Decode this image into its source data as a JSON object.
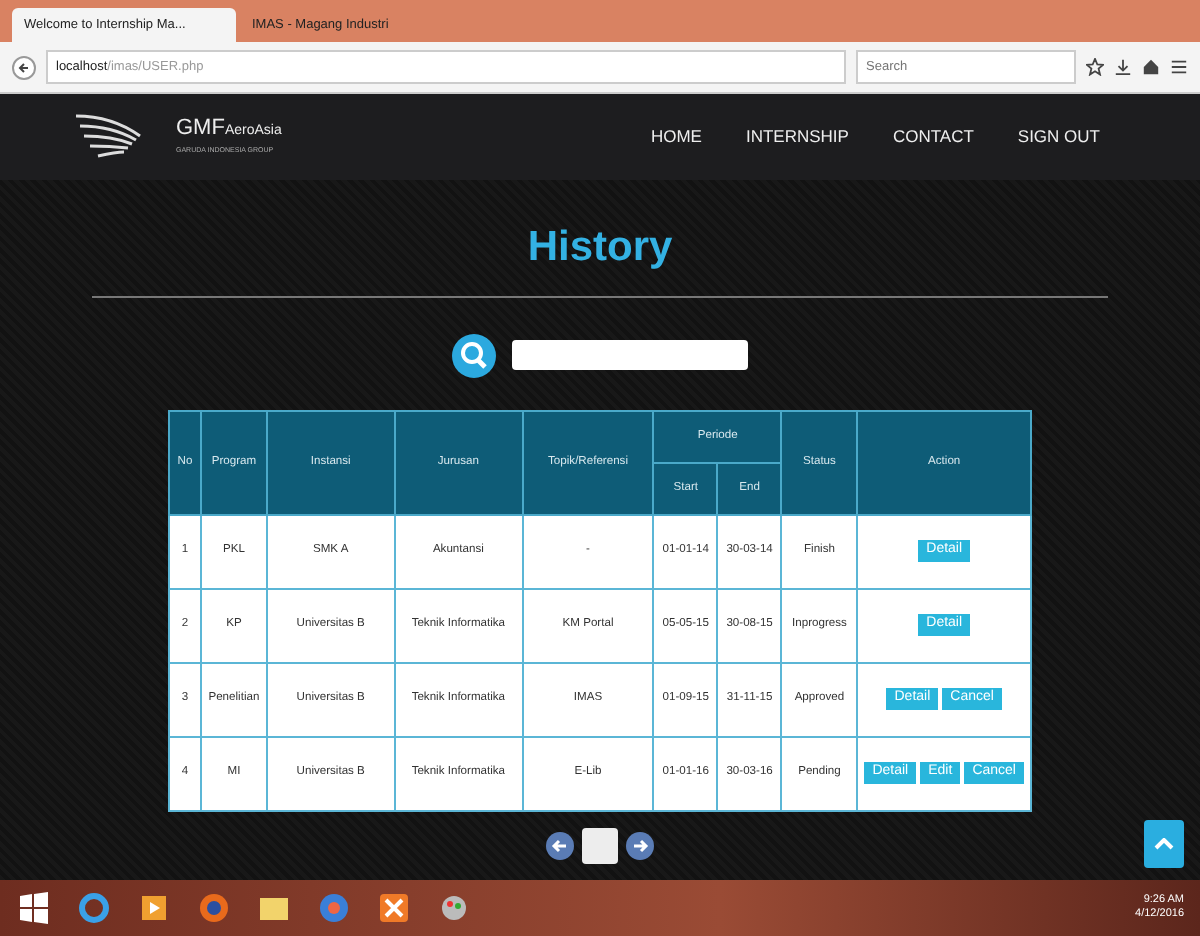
{
  "browser": {
    "tabs": [
      {
        "label": "Welcome to Internship Ma...",
        "selected": true
      },
      {
        "label": "IMAS - Magang Industri",
        "selected": false
      }
    ],
    "url_host": "localhost",
    "url_path": "/imas/USER.php",
    "search_placeholder": "Search"
  },
  "navbar": {
    "brand": "GMF",
    "brand_sub": "AeroAsia",
    "tagline": "GARUDA INDONESIA GROUP",
    "items": [
      "HOME",
      "INTERNSHIP",
      "CONTACT",
      "SIGN OUT"
    ]
  },
  "page": {
    "title": "History"
  },
  "table": {
    "columns": [
      {
        "label": "No"
      },
      {
        "label": "Program"
      },
      {
        "label": "Instansi"
      },
      {
        "label": "Jurusan"
      },
      {
        "label": "Topik/Referensi"
      },
      {
        "label": "Periode",
        "colspan": 2,
        "children": [
          "Start",
          "End"
        ]
      },
      {
        "label": "Status"
      },
      {
        "label": "Action"
      }
    ],
    "rows": [
      {
        "cells": [
          "1",
          "PKL",
          "SMK A",
          "Akuntansi",
          "-",
          "01-01-14",
          "30-03-14",
          "Finish"
        ],
        "actions": [
          "Detail"
        ]
      },
      {
        "cells": [
          "2",
          "KP",
          "Universitas B",
          "Teknik Informatika",
          "KM Portal",
          "05-05-15",
          "30-08-15",
          "Inprogress"
        ],
        "actions": [
          "Detail"
        ]
      },
      {
        "cells": [
          "3",
          "Penelitian",
          "Universitas B",
          "Teknik Informatika",
          "IMAS",
          "01-09-15",
          "31-11-15",
          "Approved"
        ],
        "actions": [
          "Detail",
          "Cancel"
        ]
      },
      {
        "cells": [
          "4",
          "MI",
          "Universitas B",
          "Teknik Informatika",
          "E-Lib",
          "01-01-16",
          "30-03-16",
          "Pending"
        ],
        "actions": [
          "Detail",
          "Edit",
          "Cancel"
        ]
      }
    ]
  },
  "taskbar": {
    "time": "9:26 AM",
    "date": "4/12/2016"
  }
}
